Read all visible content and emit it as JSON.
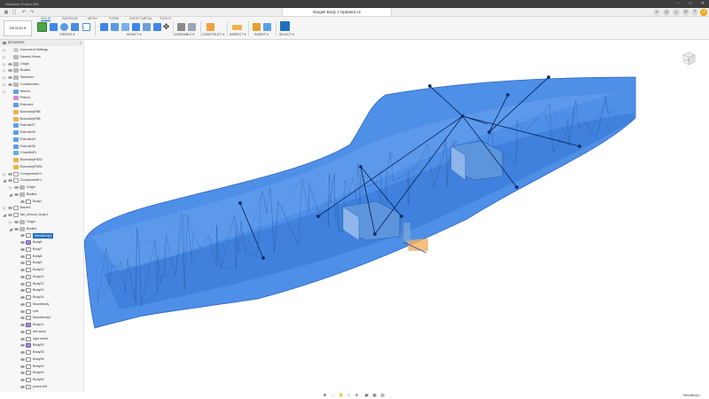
{
  "window": {
    "app_title": "Autodesk Fusion 360",
    "document_tab": "Nargek Body 2 Updated v2",
    "controls": {
      "minimize": "–",
      "maximize": "□",
      "close": "✕"
    },
    "quick_access": [
      "▦",
      "▢",
      "↶",
      "↷"
    ],
    "right_icons": [
      "+",
      "◷",
      "☺",
      "⟳",
      "?",
      "U"
    ]
  },
  "toolbar": {
    "workspace": "DESIGN ▾",
    "tabs": [
      "SOLID",
      "SURFACE",
      "MESH",
      "FORM",
      "SHEET METAL",
      "TOOLS"
    ],
    "active_tab": 0,
    "groups": [
      "CREATE ▾",
      "MODIFY ▾",
      "ASSEMBLE ▾",
      "CONSTRUCT ▾",
      "INSPECT ▾",
      "INSERT ▾",
      "SELECT ▾"
    ]
  },
  "browser": {
    "header": "BROWSER",
    "collapse": "«",
    "items": [
      {
        "label": "Document Settings",
        "depth": 1,
        "tw": "▷",
        "icon": "gear",
        "eye": false
      },
      {
        "label": "Named Views",
        "depth": 1,
        "tw": "▷",
        "icon": "folder",
        "eye": false
      },
      {
        "label": "Origin",
        "depth": 1,
        "tw": "▷",
        "icon": "folder",
        "eye": true
      },
      {
        "label": "Bodies",
        "depth": 1,
        "tw": "▷",
        "icon": "folder",
        "eye": true
      },
      {
        "label": "Sketches",
        "depth": 1,
        "tw": "▷",
        "icon": "folder",
        "eye": true
      },
      {
        "label": "Construction",
        "depth": 1,
        "tw": "▷",
        "icon": "folder",
        "eye": true
      },
      {
        "label": "Mirror1",
        "depth": 1,
        "tw": "▷",
        "icon": "feat",
        "eye": false
      },
      {
        "label": "Plane1",
        "depth": 1,
        "tw": "",
        "icon": "sheet",
        "eye": false
      },
      {
        "label": "Extrude1",
        "depth": 1,
        "tw": "",
        "icon": "feat",
        "eye": false
      },
      {
        "label": "BoundaryFill6",
        "depth": 1,
        "tw": "",
        "icon": "bnd",
        "eye": false
      },
      {
        "label": "BoundaryFill6",
        "depth": 1,
        "tw": "",
        "icon": "bnd",
        "eye": false
      },
      {
        "label": "Extrude27",
        "depth": 1,
        "tw": "",
        "icon": "feat",
        "eye": false
      },
      {
        "label": "Extrude28",
        "depth": 1,
        "tw": "",
        "icon": "feat",
        "eye": false
      },
      {
        "label": "Extrude29",
        "depth": 1,
        "tw": "",
        "icon": "feat",
        "eye": false
      },
      {
        "label": "Extrude30",
        "depth": 1,
        "tw": "",
        "icon": "feat",
        "eye": false
      },
      {
        "label": "Chamfer51",
        "depth": 1,
        "tw": "",
        "icon": "cham",
        "eye": false
      },
      {
        "label": "BoundaryFill32",
        "depth": 1,
        "tw": "",
        "icon": "bnd",
        "eye": false
      },
      {
        "label": "BoundaryFill33",
        "depth": 1,
        "tw": "",
        "icon": "bnd",
        "eye": false
      },
      {
        "label": "Component4:1",
        "depth": 1,
        "tw": "▷",
        "icon": "comp",
        "eye": true
      },
      {
        "label": "Component5:1",
        "depth": 1,
        "tw": "◢",
        "icon": "comp",
        "eye": true
      },
      {
        "label": "Origin",
        "depth": 2,
        "tw": "▷",
        "icon": "folder",
        "eye": true
      },
      {
        "label": "Bodies",
        "depth": 2,
        "tw": "◢",
        "icon": "folder",
        "eye": true
      },
      {
        "label": "Body1",
        "depth": 3,
        "tw": "",
        "icon": "body",
        "eye": true
      },
      {
        "label": "Barrel1",
        "depth": 1,
        "tw": "▷",
        "icon": "comp",
        "eye": true
      },
      {
        "label": "fan_shroud_body:1",
        "depth": 1,
        "tw": "◢",
        "icon": "comp",
        "eye": true
      },
      {
        "label": "Origin",
        "depth": 2,
        "tw": "▷",
        "icon": "folder",
        "eye": true
      },
      {
        "label": "Bodies",
        "depth": 2,
        "tw": "◢",
        "icon": "folder",
        "eye": true
      },
      {
        "label": "MeshBody1",
        "depth": 3,
        "tw": "",
        "icon": "body",
        "eye": true,
        "selected": true
      },
      {
        "label": "Body6",
        "depth": 3,
        "tw": "",
        "icon": "bodyp",
        "eye": true
      },
      {
        "label": "Body7",
        "depth": 3,
        "tw": "",
        "icon": "body",
        "eye": true
      },
      {
        "label": "Body8",
        "depth": 3,
        "tw": "",
        "icon": "body",
        "eye": true
      },
      {
        "label": "Body9",
        "depth": 3,
        "tw": "",
        "icon": "body",
        "eye": true
      },
      {
        "label": "Body10",
        "depth": 3,
        "tw": "",
        "icon": "body",
        "eye": true
      },
      {
        "label": "Body12",
        "depth": 3,
        "tw": "",
        "icon": "body",
        "eye": true
      },
      {
        "label": "Body22",
        "depth": 3,
        "tw": "",
        "icon": "body",
        "eye": true
      },
      {
        "label": "Body23",
        "depth": 3,
        "tw": "",
        "icon": "body",
        "eye": true
      },
      {
        "label": "Body24",
        "depth": 3,
        "tw": "",
        "icon": "body",
        "eye": true
      },
      {
        "label": "Mountbody",
        "depth": 3,
        "tw": "",
        "icon": "body",
        "eye": true
      },
      {
        "label": "Left",
        "depth": 3,
        "tw": "",
        "icon": "body",
        "eye": true
      },
      {
        "label": "Mountbody4",
        "depth": 3,
        "tw": "",
        "icon": "body",
        "eye": true
      },
      {
        "label": "Body11",
        "depth": 3,
        "tw": "",
        "icon": "bodyp",
        "eye": true
      },
      {
        "label": "left mesh",
        "depth": 3,
        "tw": "",
        "icon": "body",
        "eye": true
      },
      {
        "label": "right mesh",
        "depth": 3,
        "tw": "",
        "icon": "body",
        "eye": true
      },
      {
        "label": "Body34",
        "depth": 3,
        "tw": "",
        "icon": "bodyp",
        "eye": true
      },
      {
        "label": "Body35",
        "depth": 3,
        "tw": "",
        "icon": "body",
        "eye": true
      },
      {
        "label": "Body36",
        "depth": 3,
        "tw": "",
        "icon": "body",
        "eye": true
      },
      {
        "label": "Body42",
        "depth": 3,
        "tw": "",
        "icon": "body",
        "eye": true
      },
      {
        "label": "Body44",
        "depth": 3,
        "tw": "",
        "icon": "body",
        "eye": true
      },
      {
        "label": "Body45",
        "depth": 3,
        "tw": "",
        "icon": "body",
        "eye": true
      },
      {
        "label": "joined left",
        "depth": 3,
        "tw": "",
        "icon": "body",
        "eye": true
      },
      {
        "label": "Sketches",
        "depth": 2,
        "tw": "◢",
        "icon": "folder",
        "eye": true
      },
      {
        "label": "Sketch1",
        "depth": 3,
        "tw": "",
        "icon": "sketch",
        "eye": true
      }
    ]
  },
  "viewcube": {
    "face_label": "FRONT"
  },
  "navbar": {
    "icons": [
      "✥",
      "⬚",
      "✋",
      "⌕",
      "⊕",
      "▣",
      "▦",
      "▤"
    ],
    "selection_name": "MeshBody1"
  },
  "colors": {
    "body_fill": "#3f86e6",
    "body_fill_light": "#6aa2ec",
    "wire": "#1d4a92",
    "sketch_line": "#0b2a66",
    "selection": "#1f6fbf"
  }
}
